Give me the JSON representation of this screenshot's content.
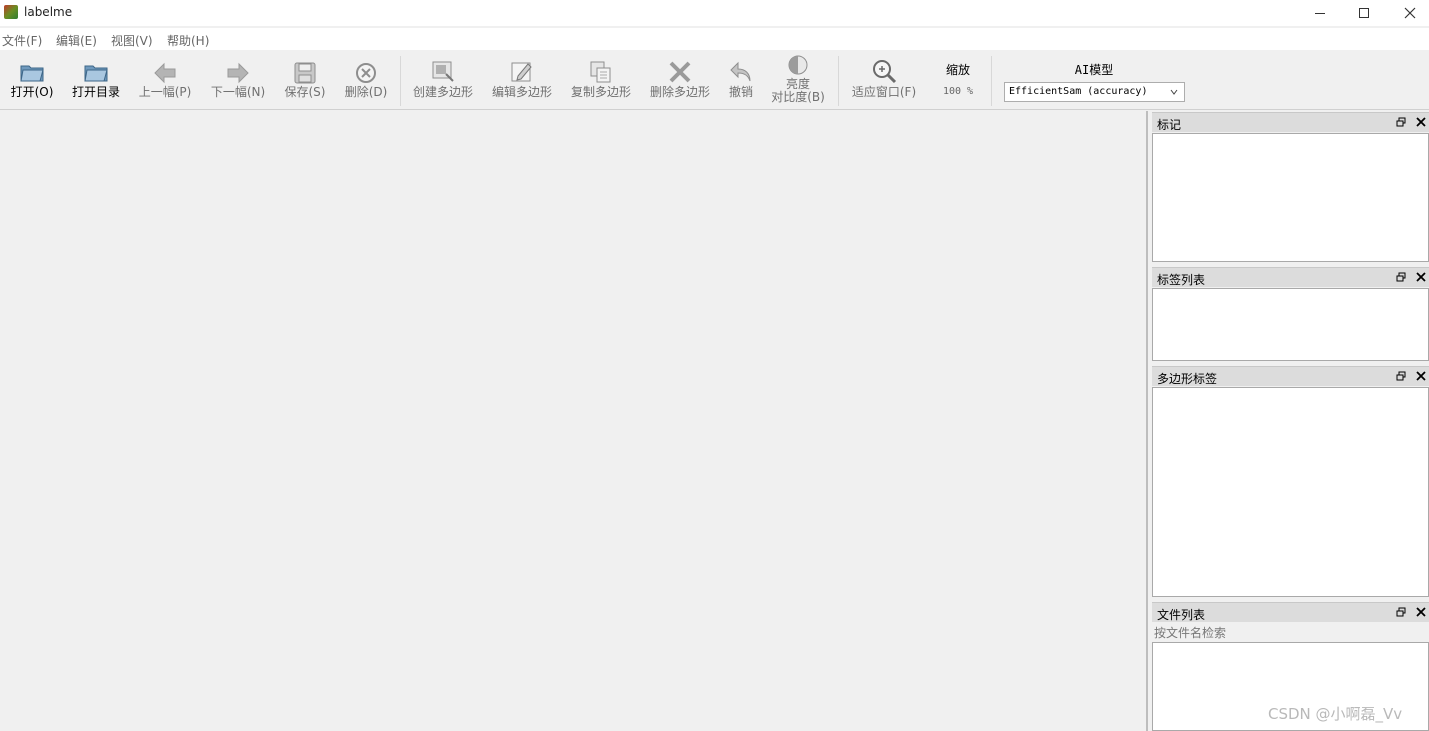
{
  "window": {
    "title": "labelme"
  },
  "menu": [
    "文件(F)",
    "编辑(E)",
    "视图(V)",
    "帮助(H)"
  ],
  "toolbar": {
    "open": "打开(O)",
    "open_dir": "打开目录",
    "prev": "上一幅(P)",
    "next": "下一幅(N)",
    "save": "保存(S)",
    "delete": "删除(D)",
    "create_polygon": "创建多边形",
    "edit_polygon": "编辑多边形",
    "copy_polygon": "复制多边形",
    "delete_polygon": "删除多边形",
    "undo": "撤销",
    "brightness_line1": "亮度",
    "brightness_line2": "对比度(B)",
    "fit_window": "适应窗口(F)",
    "zoom_title": "缩放",
    "zoom_value": "100 %",
    "ai_title": "AI模型",
    "ai_model": "EfficientSam (accuracy)"
  },
  "docks": {
    "flags": "标记",
    "label_list": "标签列表",
    "polygon_labels": "多边形标签",
    "file_list": "文件列表",
    "file_search_placeholder": "按文件名检索"
  },
  "watermark": "CSDN @小啊磊_Vv"
}
